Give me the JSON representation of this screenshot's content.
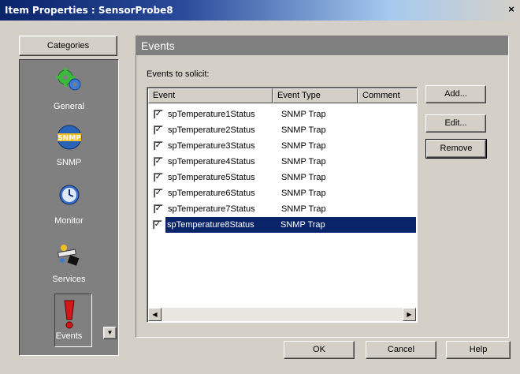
{
  "window": {
    "title": "Item Properties : SensorProbe8",
    "close_glyph": "×"
  },
  "categories": {
    "header": "Categories",
    "items": [
      {
        "label": "General",
        "icon": "gears-icon"
      },
      {
        "label": "SNMP",
        "icon": "snmp-icon",
        "badge": "SNMP"
      },
      {
        "label": "Monitor",
        "icon": "clock-icon"
      },
      {
        "label": "Services",
        "icon": "services-icon"
      },
      {
        "label": "Events",
        "icon": "exclamation-icon",
        "selected": true
      }
    ]
  },
  "events": {
    "header": "Events",
    "solicit_label": "Events to solicit:",
    "columns": [
      "Event",
      "Event Type",
      "Comment"
    ],
    "rows": [
      {
        "event": "spTemperature1Status",
        "type": "SNMP Trap",
        "checked": true,
        "selected": false
      },
      {
        "event": "spTemperature2Status",
        "type": "SNMP Trap",
        "checked": true,
        "selected": false
      },
      {
        "event": "spTemperature3Status",
        "type": "SNMP Trap",
        "checked": true,
        "selected": false
      },
      {
        "event": "spTemperature4Status",
        "type": "SNMP Trap",
        "checked": true,
        "selected": false
      },
      {
        "event": "spTemperature5Status",
        "type": "SNMP Trap",
        "checked": true,
        "selected": false
      },
      {
        "event": "spTemperature6Status",
        "type": "SNMP Trap",
        "checked": true,
        "selected": false
      },
      {
        "event": "spTemperature7Status",
        "type": "SNMP Trap",
        "checked": true,
        "selected": false
      },
      {
        "event": "spTemperature8Status",
        "type": "SNMP Trap",
        "checked": true,
        "selected": true
      }
    ],
    "buttons": {
      "add": "Add...",
      "edit": "Edit...",
      "remove": "Remove"
    }
  },
  "footer": {
    "ok": "OK",
    "cancel": "Cancel",
    "help": "Help"
  },
  "colors": {
    "title_bar": "#0a246a",
    "selection": "#0a246a",
    "panel_gray": "#808080",
    "face": "#d4d0c8"
  }
}
